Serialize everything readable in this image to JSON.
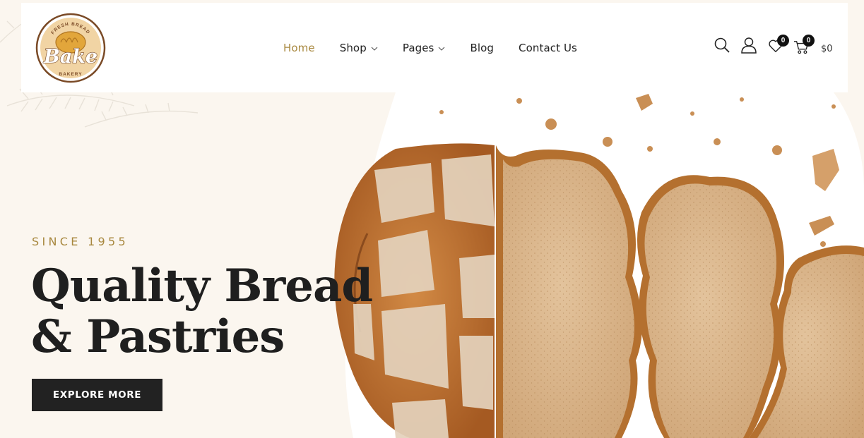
{
  "logo": {
    "top_text": "FRESH BREAD",
    "brand": "Bake",
    "bottom_text": "BAKERY",
    "colors": {
      "ring": "#7a4a26",
      "fill": "#f1d4a4",
      "bun": "#e2a63b"
    }
  },
  "nav": {
    "items": [
      {
        "label": "Home",
        "active": true,
        "has_dropdown": false
      },
      {
        "label": "Shop",
        "active": false,
        "has_dropdown": true
      },
      {
        "label": "Pages",
        "active": false,
        "has_dropdown": true
      },
      {
        "label": "Blog",
        "active": false,
        "has_dropdown": false
      },
      {
        "label": "Contact Us",
        "active": false,
        "has_dropdown": false
      }
    ],
    "active_color": "#a8883f"
  },
  "header_icons": {
    "search": "search-icon",
    "account": "user-icon",
    "wishlist": {
      "icon": "heart-icon",
      "count": "0"
    },
    "cart": {
      "icon": "cart-icon",
      "count": "0",
      "total": "$0"
    }
  },
  "hero": {
    "eyebrow": "SINCE 1955",
    "title_line1": "Quality Bread",
    "title_line2": "& Pastries",
    "cta_label": "EXPLORE MORE",
    "image": "sliced-rustic-bread-loaf",
    "colors": {
      "background": "#fbf6ef",
      "accent": "#a8883f",
      "button": "#222222"
    }
  }
}
